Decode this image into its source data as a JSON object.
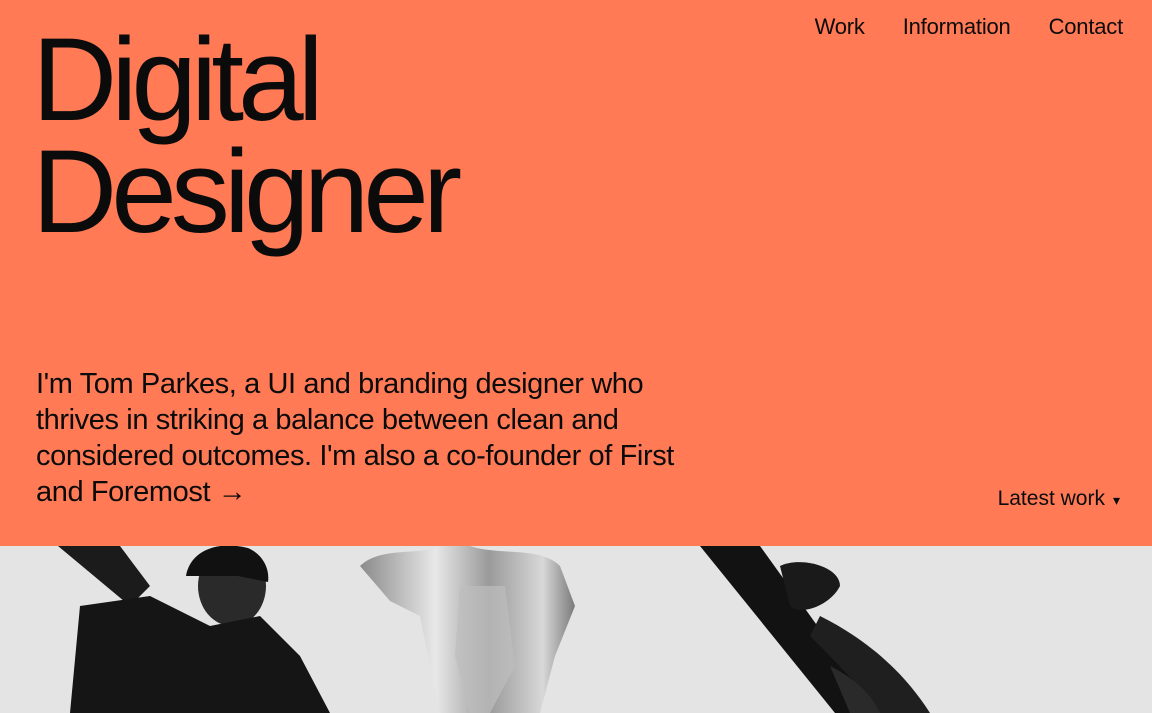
{
  "nav": {
    "items": [
      {
        "label": "Work"
      },
      {
        "label": "Information"
      },
      {
        "label": "Contact"
      }
    ]
  },
  "hero": {
    "title_line1": "Digital",
    "title_line2": "Designer",
    "intro_text": "I'm Tom Parkes, a UI and branding designer who thrives in striking a balance between clean and considered outcomes. I'm also a",
    "intro_link": "co-founder of First and Foremost",
    "intro_arrow": "→",
    "latest_label": "Latest work",
    "latest_caret": "▾"
  },
  "colors": {
    "accent": "#ff7a55",
    "text": "#0b0b0b",
    "photo_bg": "#e6e6e6"
  }
}
